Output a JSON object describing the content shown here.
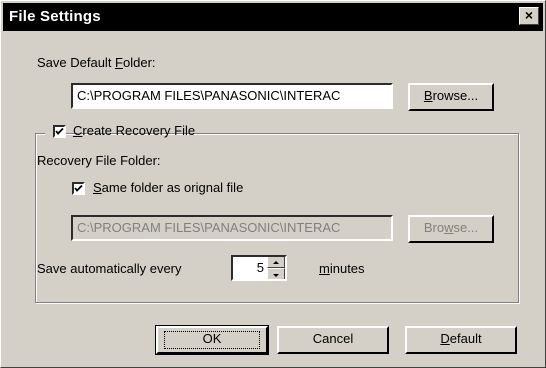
{
  "window": {
    "title": "File Settings",
    "close_glyph": "×"
  },
  "save_default_folder": {
    "label_pre": "Save Default ",
    "label_key": "F",
    "label_post": "older:",
    "path": "C:\\PROGRAM FILES\\PANASONIC\\INTERAC",
    "browse_key": "B",
    "browse_rest": "rowse..."
  },
  "recovery": {
    "checkbox_key": "C",
    "checkbox_rest": "reate Recovery File",
    "checked": true,
    "folder_label": "Recovery File Folder:",
    "same_key": "S",
    "same_rest": "ame folder as orignal file",
    "same_checked": true,
    "path": "C:\\PROGRAM FILES\\PANASONIC\\INTERAC",
    "browse_pre": "Bro",
    "browse_key": "w",
    "browse_post": "se...",
    "autosave_label": "Save automatically every",
    "autosave_value": "5",
    "minutes_key": "m",
    "minutes_rest": "inutes"
  },
  "buttons": {
    "ok": "OK",
    "cancel": "Cancel",
    "default_key": "D",
    "default_rest": "efault"
  }
}
